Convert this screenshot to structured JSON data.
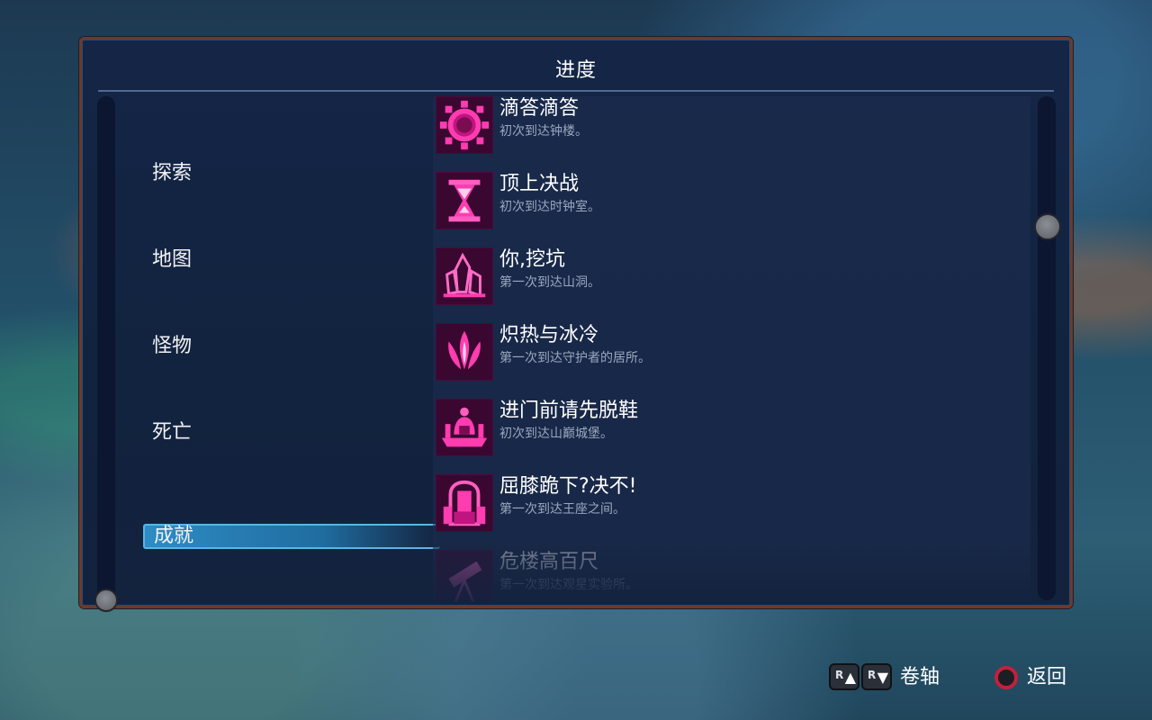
{
  "panel": {
    "title": "进度"
  },
  "nav": {
    "items": [
      {
        "label": "探索"
      },
      {
        "label": "地图"
      },
      {
        "label": "怪物"
      },
      {
        "label": "死亡"
      },
      {
        "label": "成就",
        "selected": true
      }
    ]
  },
  "achievements": [
    {
      "title": "滴答滴答",
      "desc": "初次到达钟楼。",
      "icon": "gear-icon"
    },
    {
      "title": "顶上决战",
      "desc": "初次到达时钟室。",
      "icon": "hourglass-icon"
    },
    {
      "title": "你,挖坑",
      "desc": "第一次到达山洞。",
      "icon": "crystal-icon"
    },
    {
      "title": "炽热与冰冷",
      "desc": "第一次到达守护者的居所。",
      "icon": "flame-icon"
    },
    {
      "title": "进门前请先脱鞋",
      "desc": "初次到达山巅城堡。",
      "icon": "castle-icon"
    },
    {
      "title": "屈膝跪下?决不!",
      "desc": "第一次到达王座之间。",
      "icon": "throne-icon"
    },
    {
      "title": "危楼高百尺",
      "desc": "第一次到达观星实验所。",
      "icon": "telescope-icon"
    }
  ],
  "footer": {
    "scroll_label": "卷轴",
    "back_label": "返回",
    "r_up_glyph": "R",
    "r_down_glyph": "R"
  },
  "colors": {
    "accent_magenta": "#ff2fa8",
    "selected_blue": "#2e8cc4",
    "frame_copper": "#6a3b2c"
  }
}
